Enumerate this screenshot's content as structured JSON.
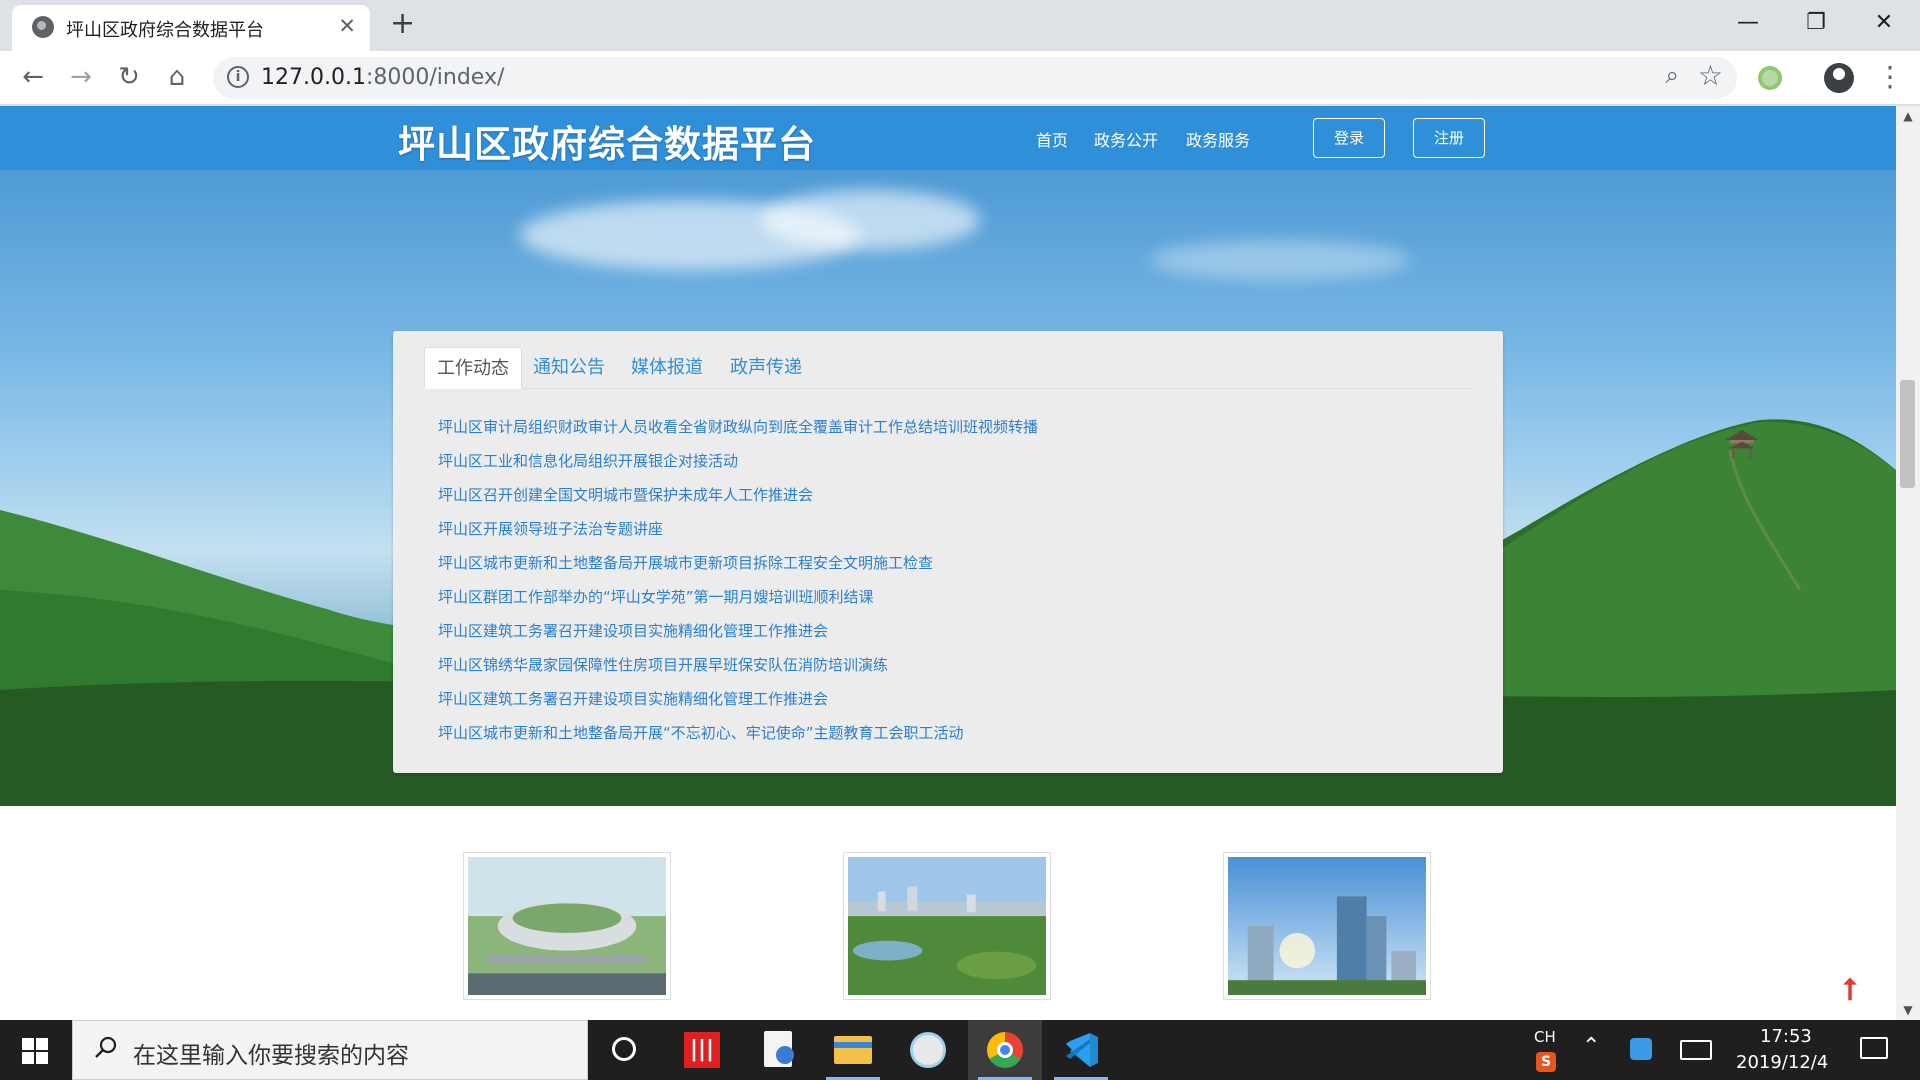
{
  "browser": {
    "tab_title": "坪山区政府综合数据平台",
    "url_host": "127.0.0.1",
    "url_path": ":8000/index/"
  },
  "site": {
    "title": "坪山区政府综合数据平台",
    "nav": [
      "首页",
      "政务公开",
      "政务服务"
    ],
    "login_label": "登录",
    "register_label": "注册"
  },
  "news_panel": {
    "tabs": [
      "工作动态",
      "通知公告",
      "媒体报道",
      "政声传递"
    ],
    "active_tab": "工作动态",
    "items": [
      "坪山区审计局组织财政审计人员收看全省财政纵向到底全覆盖审计工作总结培训班视频转播",
      "坪山区工业和信息化局组织开展银企对接活动",
      "坪山区召开创建全国文明城市暨保护未成年人工作推进会",
      "坪山区开展领导班子法治专题讲座",
      "坪山区城市更新和土地整备局开展城市更新项目拆除工程安全文明施工检查",
      "坪山区群团工作部举办的“坪山女学苑”第一期月嫂培训班顺利结课",
      "坪山区建筑工务署召开建设项目实施精细化管理工作推进会",
      "坪山区锦绣华晟家园保障性住房项目开展早班保安队伍消防培训演练",
      "坪山区建筑工务署召开建设项目实施精细化管理工作推进会",
      "坪山区城市更新和土地整备局开展“不忘初心、牢记使命”主题教育工会职工活动"
    ]
  },
  "taskbar": {
    "search_placeholder": "在这里输入你要搜索的内容",
    "ime": "CH",
    "time": "17:53",
    "date": "2019/12/4"
  },
  "colors": {
    "header_blue": "#2f8fd9",
    "link_blue": "#2a7fd0"
  }
}
